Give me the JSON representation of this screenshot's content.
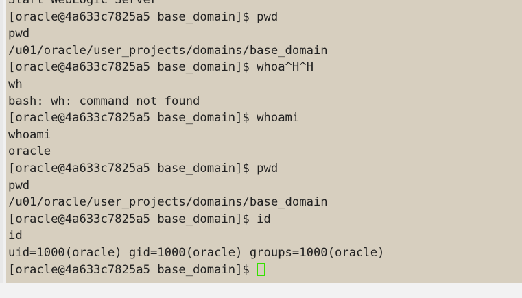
{
  "terminal": {
    "lines": [
      "Start WebLogic Server",
      "[oracle@4a633c7825a5 base_domain]$ pwd",
      "pwd",
      "/u01/oracle/user_projects/domains/base_domain",
      "[oracle@4a633c7825a5 base_domain]$ whoa^H^H",
      "wh",
      "bash: wh: command not found",
      "[oracle@4a633c7825a5 base_domain]$ whoami",
      "whoami",
      "oracle",
      "[oracle@4a633c7825a5 base_domain]$ pwd",
      "pwd",
      "/u01/oracle/user_projects/domains/base_domain",
      "[oracle@4a633c7825a5 base_domain]$ id",
      "id",
      "uid=1000(oracle) gid=1000(oracle) groups=1000(oracle)",
      "[oracle@4a633c7825a5 base_domain]$ "
    ],
    "colors": {
      "background": "#d7cfbf",
      "text": "#222222",
      "cursor": "#35e000"
    }
  }
}
